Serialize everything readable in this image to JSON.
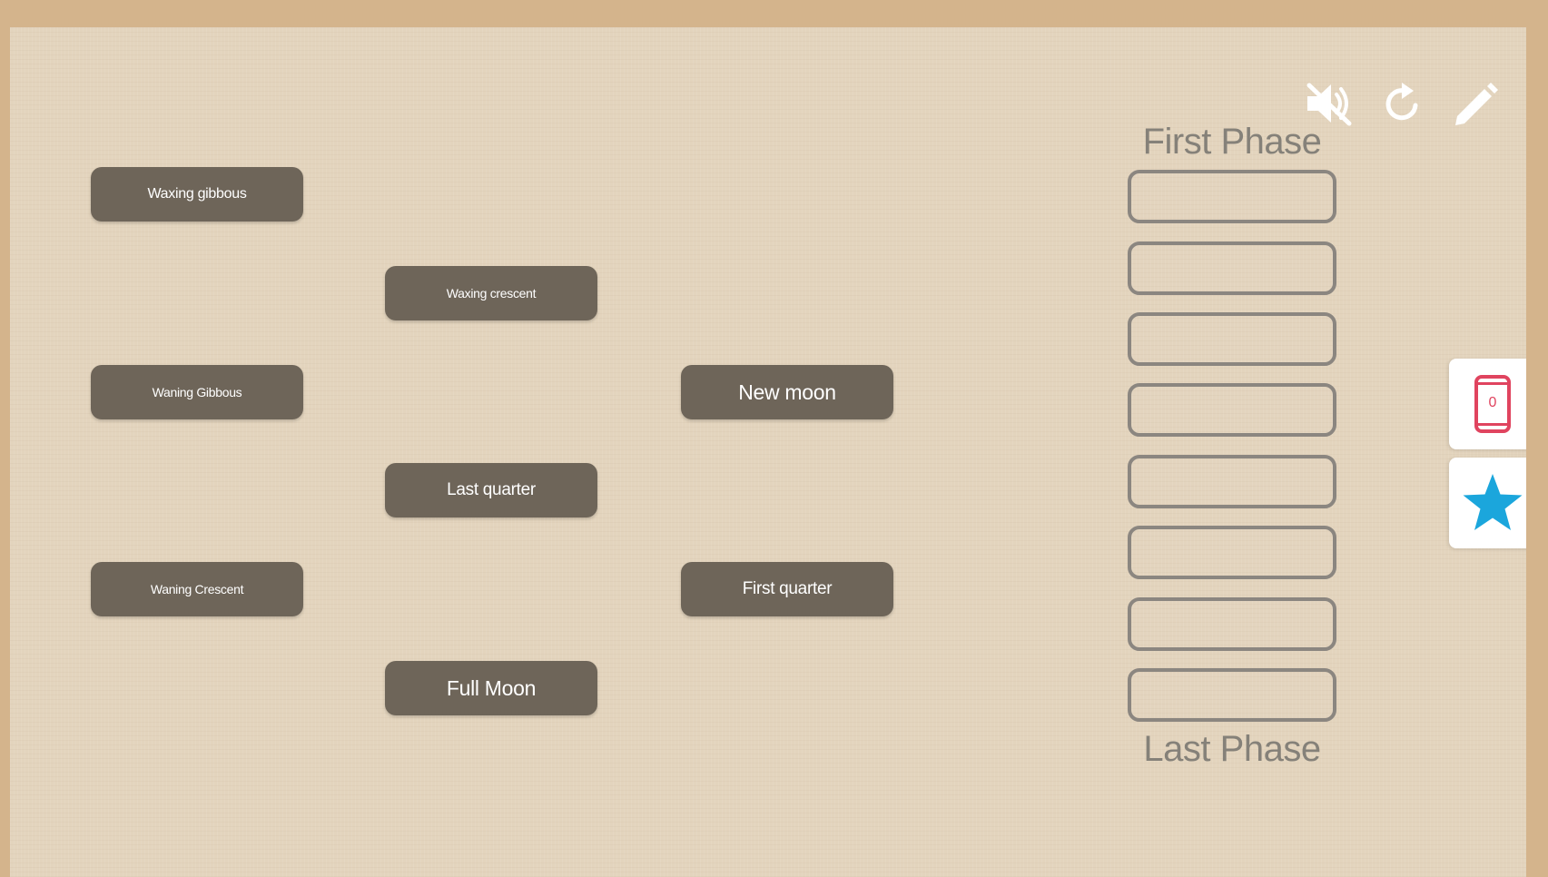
{
  "toolbar": {
    "mute_icon": "speaker-muted-icon",
    "restart_icon": "refresh-icon",
    "edit_icon": "pencil-icon"
  },
  "cards": [
    {
      "label": "Waxing gibbous"
    },
    {
      "label": "Waxing crescent"
    },
    {
      "label": "Waning Gibbous"
    },
    {
      "label": "New moon"
    },
    {
      "label": "Last quarter"
    },
    {
      "label": "Waning Crescent"
    },
    {
      "label": "First quarter"
    },
    {
      "label": "Full Moon"
    }
  ],
  "sequence": {
    "first_label": "First Phase",
    "last_label": "Last Phase",
    "slot_count": 8
  },
  "side_panel": {
    "phone_count": "0",
    "phone_icon": "phone-icon",
    "star_icon": "star-icon",
    "accent_phone": "#e0445f",
    "accent_star": "#1ba6dc"
  },
  "colors": {
    "outer_border": "#d4b48c",
    "board_background": "#e3d4bd",
    "card_fill": "#6e6559",
    "slot_border": "#8b8680"
  }
}
